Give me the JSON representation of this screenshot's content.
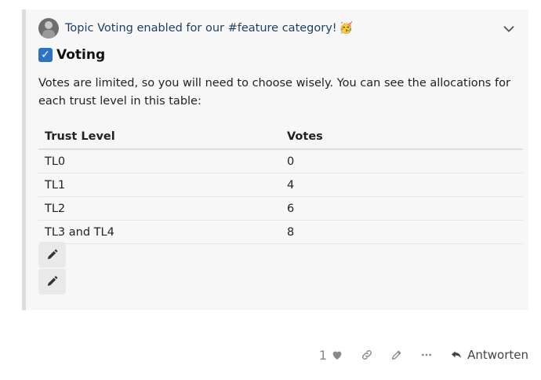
{
  "quote": {
    "title": "Topic Voting enabled for our #feature category!",
    "title_emoji": "🥳"
  },
  "section": {
    "checkbox": "✓",
    "heading": "Voting"
  },
  "body_text": "Votes are limited, so you will need to choose wisely. You can see the allocations for each trust level in this table:",
  "table": {
    "headers": [
      "Trust Level",
      "Votes"
    ],
    "rows": [
      [
        "TL0",
        "0"
      ],
      [
        "TL1",
        "4"
      ],
      [
        "TL2",
        "6"
      ],
      [
        "TL3 and TL4",
        "8"
      ]
    ]
  },
  "post_actions": {
    "like_count": "1",
    "reply_label": "Antworten"
  },
  "icons": {
    "chevron": "chevron-down-icon",
    "checkbox": "checkbox-icon",
    "edit": "pencil-icon",
    "like": "heart-icon",
    "link": "link-icon",
    "more": "ellipsis-icon",
    "reply": "reply-icon"
  },
  "colors": {
    "accent": "#2b73c8",
    "title": "#1f3f66"
  }
}
